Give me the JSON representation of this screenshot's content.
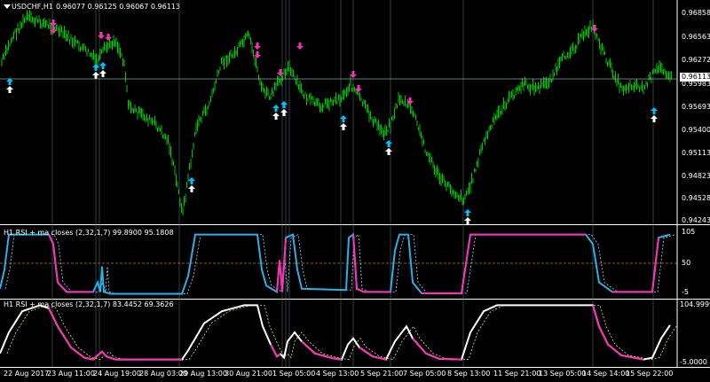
{
  "main": {
    "title": "USDCHF,H1",
    "ohlc": "0.96077 0.96125 0.96067 0.96113",
    "current_price": "0.96113",
    "price_labels": [
      "0.96858",
      "0.96563",
      "0.96272",
      "0.95983",
      "0.95693",
      "0.95400",
      "0.95113",
      "0.94823",
      "0.94528",
      "0.94243"
    ],
    "colors": {
      "candle": "#00c800",
      "arrow_up": "#00bfff",
      "arrow_down": "#ff2fb5",
      "grid": "#334a4a",
      "vline": "#4a6a6a"
    }
  },
  "indicator1": {
    "label": "H1 RSI + ma closes (2,32,1,7) 99.8900 95.1808",
    "levels": [
      "105",
      "50",
      "-5",
      "100"
    ],
    "colors": {
      "line": "#2bb0e8",
      "alt": "#ff2fb5",
      "signal": "#9fd8ff",
      "level": "#c08030"
    }
  },
  "indicator2": {
    "label": "H1 RSI + ma closes (2,32,1,7) 83.4452 69.3626",
    "levels": [
      "104.9999",
      "-5.0000"
    ],
    "colors": {
      "line": "#ffffff",
      "alt": "#ff2fb5",
      "signal": "#e8e85a"
    }
  },
  "time_labels": [
    "22 Aug 2017",
    "23 Aug 11:00",
    "24 Aug 19:00",
    "28 Aug 03:00",
    "29 Aug 13:00",
    "30 Aug 21:00",
    "1 Sep 05:00",
    "4 Sep 13:00",
    "5 Sep 21:00",
    "7 Sep 05:00",
    "8 Sep 13:00",
    "11 Sep 21:00",
    "13 Sep 05:00",
    "14 Sep 14:00",
    "15 Sep 22:00"
  ]
}
